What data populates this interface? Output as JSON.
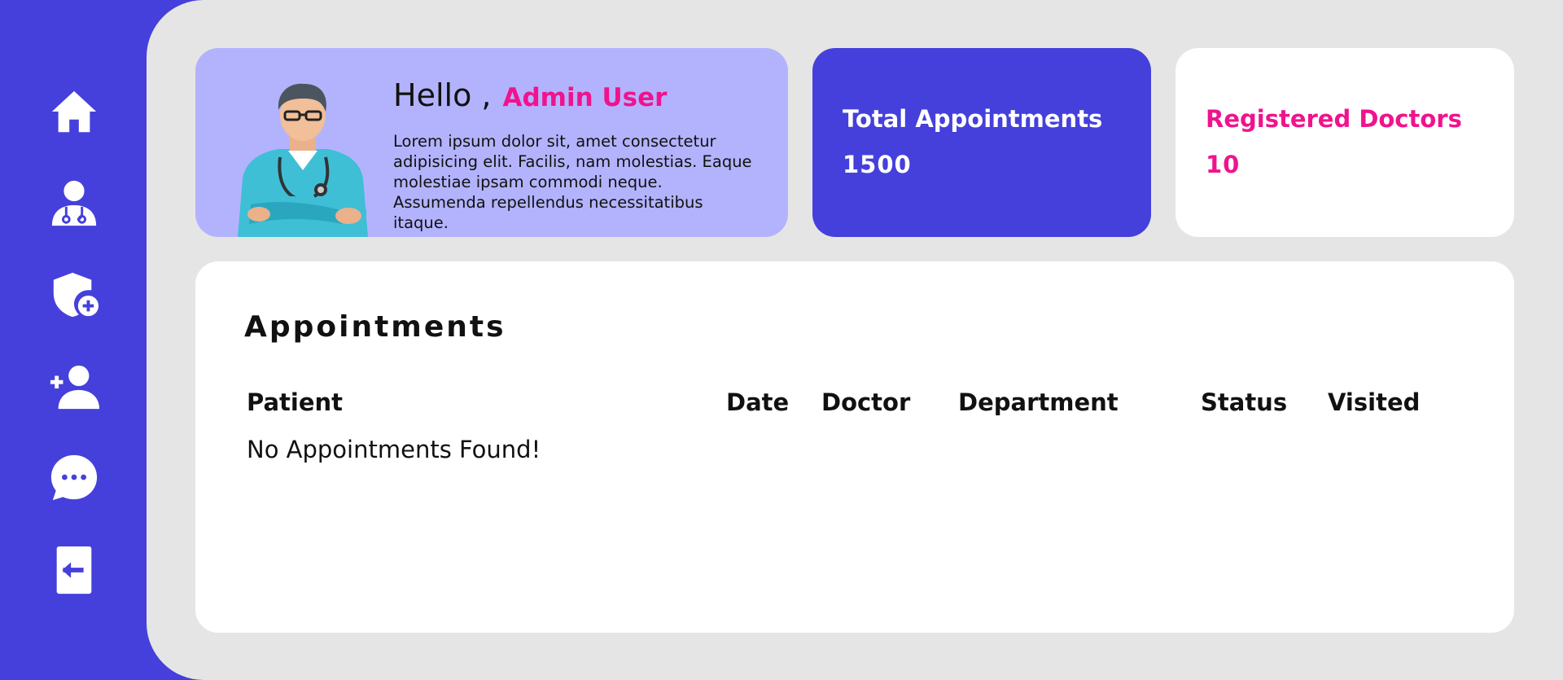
{
  "sidebar": {
    "items": [
      {
        "icon": "home-icon"
      },
      {
        "icon": "doctor-icon"
      },
      {
        "icon": "shield-plus-icon"
      },
      {
        "icon": "add-user-icon"
      },
      {
        "icon": "chat-icon"
      },
      {
        "icon": "logout-icon"
      }
    ]
  },
  "welcome": {
    "greeting": "Hello ,",
    "user_name": "Admin User",
    "intro": "Lorem ipsum dolor sit, amet consectetur adipisicing elit. Facilis, nam molestias. Eaque molestiae ipsam commodi neque. Assumenda repellendus necessitatibus itaque."
  },
  "stats": {
    "total_appointments": {
      "label": "Total Appointments",
      "value": "1500"
    },
    "registered_doctors": {
      "label": "Registered Doctors",
      "value": "10"
    }
  },
  "appointments": {
    "title": "Appointments",
    "columns": [
      "Patient",
      "Date",
      "Doctor",
      "Department",
      "Status",
      "Visited"
    ],
    "empty_message": "No Appointments Found!"
  },
  "colors": {
    "accent": "#4540db",
    "pink": "#f0138d",
    "welcome_bg": "#b3b3fd",
    "main_bg": "#e5e5e5"
  }
}
